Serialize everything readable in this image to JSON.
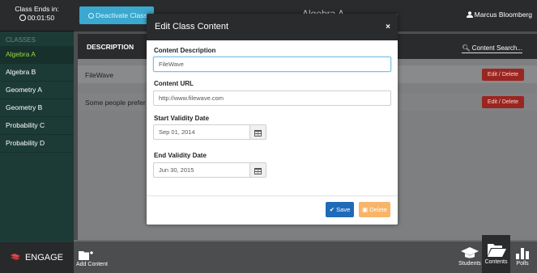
{
  "timer": {
    "label": "Class Ends in:",
    "value": "00:01:50"
  },
  "sidebar": {
    "header": "CLASSES",
    "items": [
      {
        "label": "Algebra A",
        "active": true
      },
      {
        "label": "Algebra B",
        "active": false
      },
      {
        "label": "Geometry A",
        "active": false
      },
      {
        "label": "Geometry B",
        "active": false
      },
      {
        "label": "Probability C",
        "active": false
      },
      {
        "label": "Probability D",
        "active": false
      }
    ],
    "brand": "ENGAGE"
  },
  "topbar": {
    "deactivate_label": "Deactivate Class",
    "class_name": "Algebra A",
    "user_name": "Marcus Bloomberg"
  },
  "table": {
    "column_header": "DESCRIPTION",
    "search_placeholder": "Content Search...",
    "rows": [
      {
        "description": "FileWave",
        "action_label": "Edit / Delete"
      },
      {
        "description": "Some people prefer tha",
        "action_label": "Edit / Delete"
      }
    ]
  },
  "bottombar": {
    "add_content_label": "Add Content",
    "tabs": [
      {
        "label": "Students",
        "icon": "graduation-cap-icon"
      },
      {
        "label": "Contents",
        "icon": "folder-open-icon",
        "active": true
      },
      {
        "label": "Polls",
        "icon": "bar-chart-icon"
      }
    ]
  },
  "modal": {
    "title": "Edit Class Content",
    "close_glyph": "×",
    "content_description_label": "Content Description",
    "content_description_value": "FileWave",
    "content_url_label": "Content URL",
    "content_url_value": "http://www.filewave.com",
    "start_date_label": "Start Validity Date",
    "start_date_value": "Sep 01, 2014",
    "end_date_label": "End Validity Date",
    "end_date_value": "Jun 30, 2015",
    "save_label": "Save",
    "delete_label": "Delete"
  },
  "colors": {
    "accent_blue": "#3aa8cf",
    "active_green": "#9ad93d",
    "danger_red": "#9b2520",
    "save_blue": "#1e6bb8",
    "delete_orange": "#f8b56a"
  }
}
